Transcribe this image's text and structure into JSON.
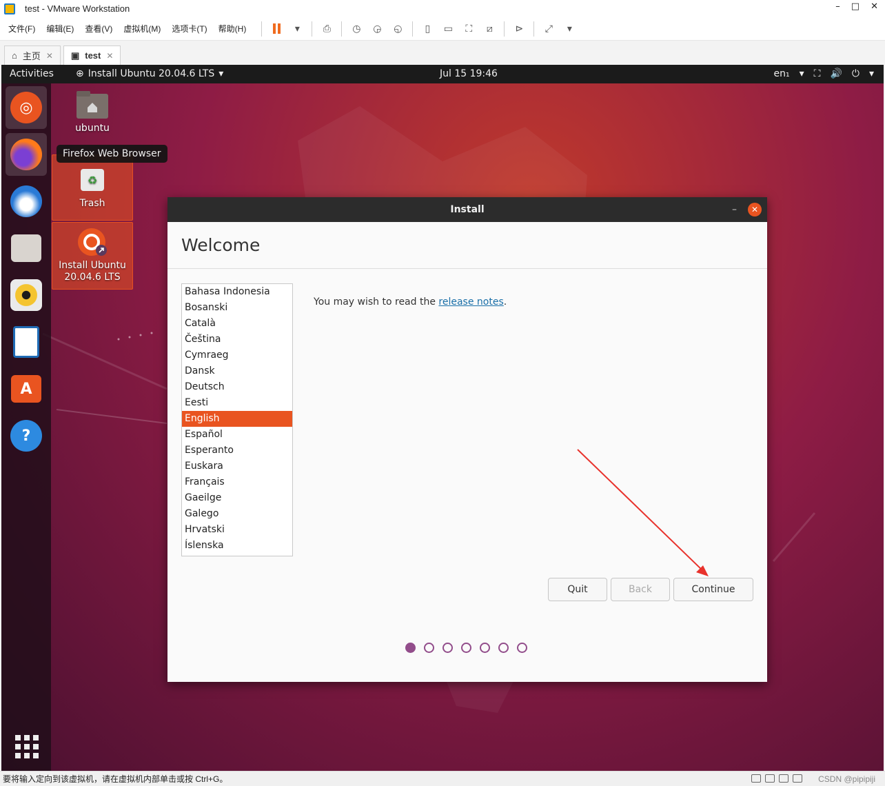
{
  "window": {
    "title": "test - VMware Workstation",
    "minimize": "–",
    "maximize": "□",
    "close": "✕"
  },
  "menubar": {
    "items": [
      "文件(F)",
      "编辑(E)",
      "查看(V)",
      "虚拟机(M)",
      "选项卡(T)",
      "帮助(H)"
    ]
  },
  "tabs": [
    {
      "label": "主页",
      "close": "✕"
    },
    {
      "label": "test",
      "close": "✕"
    }
  ],
  "guest": {
    "topbar": {
      "activities": "Activities",
      "app_menu": "Install Ubuntu 20.04.6 LTS",
      "clock": "Jul 15  19:46",
      "lang": "en₁"
    },
    "tooltip": "Firefox Web Browser",
    "desktop_icons": [
      {
        "label": "ubuntu"
      },
      {
        "label": "Trash"
      },
      {
        "label": "Install Ubuntu 20.04.6 LTS"
      }
    ],
    "installer": {
      "title": "Install",
      "heading": "Welcome",
      "languages": [
        "Bahasa Indonesia",
        "Bosanski",
        "Català",
        "Čeština",
        "Cymraeg",
        "Dansk",
        "Deutsch",
        "Eesti",
        "English",
        "Español",
        "Esperanto",
        "Euskara",
        "Français",
        "Gaeilge",
        "Galego",
        "Hrvatski",
        "Íslenska"
      ],
      "selected_language": "English",
      "notes_prefix": "You may wish to read the ",
      "notes_link": "release notes",
      "notes_suffix": ".",
      "buttons": {
        "quit": "Quit",
        "back": "Back",
        "continue": "Continue"
      },
      "progress": {
        "total_steps": 7,
        "current_step": 1
      }
    }
  },
  "statusbar": {
    "message": "要将输入定向到该虚拟机，请在虚拟机内部单击或按 Ctrl+G。",
    "watermark": "CSDN @pipipiji"
  },
  "colors": {
    "ubuntu_orange": "#e95420",
    "aubergine": "#924d8b",
    "pause_orange": "#f06b1f"
  }
}
